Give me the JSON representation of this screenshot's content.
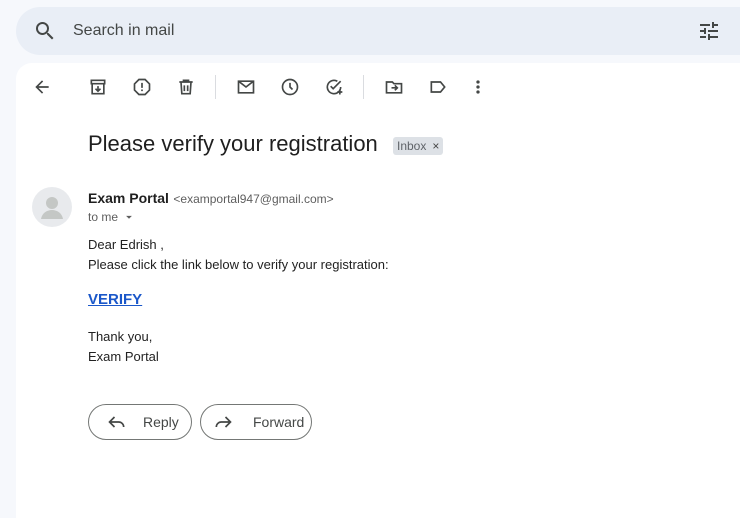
{
  "search": {
    "placeholder": "Search in mail"
  },
  "email": {
    "subject": "Please verify your registration",
    "label": "Inbox",
    "label_close": "×",
    "sender_name": "Exam Portal",
    "sender_email": "<examportal947@gmail.com>",
    "to": "to me",
    "body": {
      "greeting": "Dear Edrish ,",
      "instruction": "Please click the link below to verify your registration:",
      "link": "VERIFY",
      "closing": "Thank you,",
      "signature": "Exam Portal"
    }
  },
  "actions": {
    "reply": "Reply",
    "forward": "Forward"
  },
  "icons": {
    "search": "search-icon",
    "filters": "tune-icon",
    "back": "arrow-back-icon",
    "archive": "archive-icon",
    "spam": "report-spam-icon",
    "delete": "delete-icon",
    "unread": "mark-unread-icon",
    "snooze": "snooze-icon",
    "task": "add-task-icon",
    "move": "move-to-icon",
    "labels": "label-icon",
    "more": "more-vert-icon",
    "reply": "reply-icon",
    "forward": "forward-icon"
  },
  "colors": {
    "link": "#1a57c9",
    "search_bg": "#e9eef6",
    "page_bg": "#f6f8fc"
  }
}
